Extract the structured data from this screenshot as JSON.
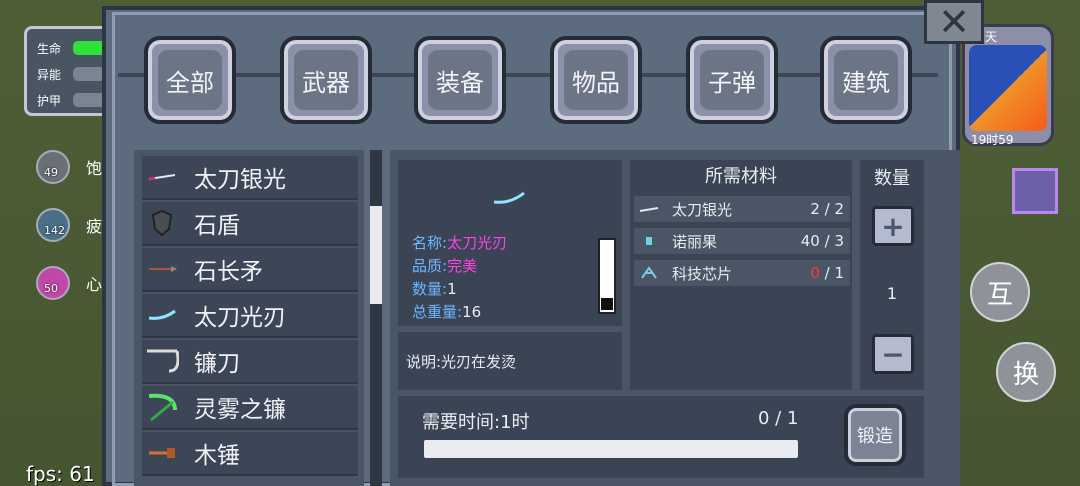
{
  "hud": {
    "stats": [
      {
        "label": "生命",
        "level": 1.0,
        "color": "#2fe23a"
      },
      {
        "label": "异能",
        "level": 0.0,
        "color": "#7a8594"
      },
      {
        "label": "护甲",
        "level": 0.0,
        "color": "#7a8594"
      }
    ],
    "status": [
      {
        "value": "49",
        "label": "饱"
      },
      {
        "value": "142",
        "label": "疲"
      },
      {
        "value": "50",
        "label": "心"
      }
    ],
    "day_label": "天",
    "time": "19时59",
    "fps": "fps: 61",
    "interact_button": "互",
    "swap_button": "换"
  },
  "tabs": [
    "全部",
    "武器",
    "装备",
    "物品",
    "子弹",
    "建筑"
  ],
  "item_list": [
    {
      "label": "太刀银光",
      "icon": "katana-icon"
    },
    {
      "label": "石盾",
      "icon": "shield-icon"
    },
    {
      "label": "石长矛",
      "icon": "spear-icon"
    },
    {
      "label": "太刀光刃",
      "icon": "blade-icon"
    },
    {
      "label": "镰刀",
      "icon": "scythe-icon"
    },
    {
      "label": "灵雾之镰",
      "icon": "green-scythe-icon"
    },
    {
      "label": "木锤",
      "icon": "hammer-icon"
    }
  ],
  "selected_item": {
    "name_key": "名称:",
    "name": "太刀光刃",
    "quality_key": "品质:",
    "quality": "完美",
    "count_key": "数量:",
    "count": "1",
    "weight_key": "总重量:",
    "weight": "16",
    "description": "说明:光刃在发烫"
  },
  "materials": {
    "title": "所需材料",
    "rows": [
      {
        "name": "太刀银光",
        "have": "2",
        "sep": " / ",
        "need": "2",
        "short": false
      },
      {
        "name": "诺丽果",
        "have": "40",
        "sep": " / ",
        "need": "3",
        "short": false
      },
      {
        "name": "科技芯片",
        "have": "0",
        "sep": " / ",
        "need": "1",
        "short": true
      }
    ]
  },
  "quantity": {
    "title": "数量",
    "value": "1",
    "plus": "+",
    "minus": "−"
  },
  "craft": {
    "time_label": "需要时间:1时",
    "progress": "0 / 1",
    "progress_fraction": 0,
    "button": "锻造"
  },
  "colors": {
    "accent_purple": "#ff41e8",
    "key_blue": "#6fb7ff",
    "shortage_red": "#ff3b2f"
  }
}
